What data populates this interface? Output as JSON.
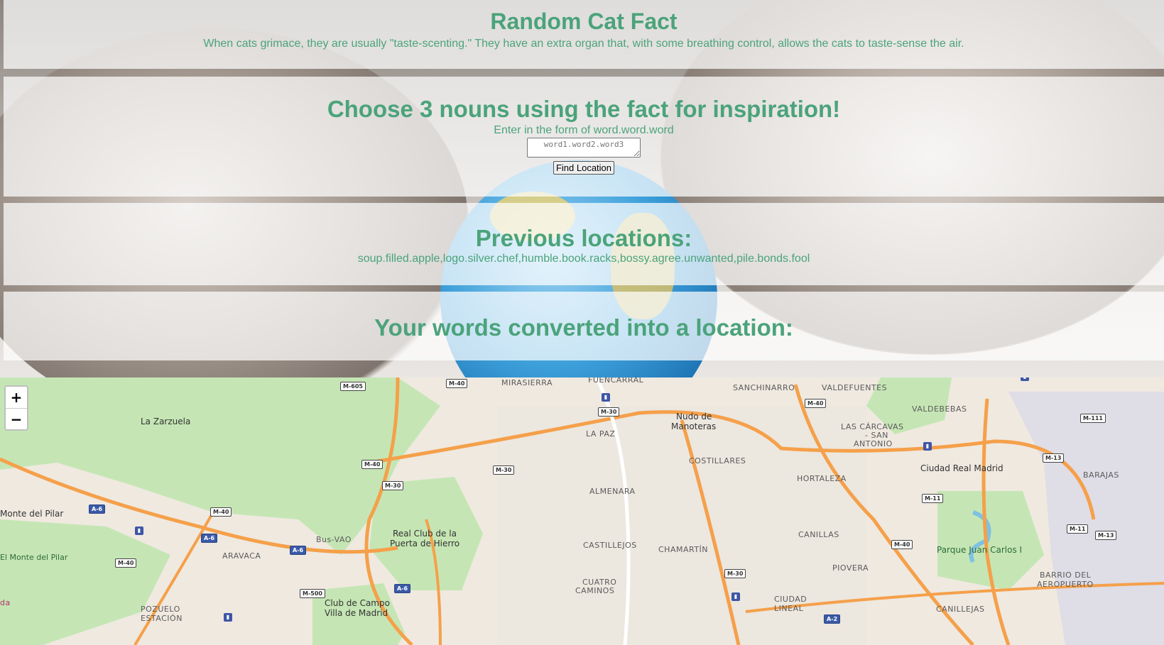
{
  "fact": {
    "title": "Random Cat Fact",
    "text": "When cats grimace, they are usually \"taste-scenting.\" They have an extra organ that, with some breathing control, allows the cats to taste-sense the air."
  },
  "choose": {
    "title": "Choose 3 nouns using the fact for inspiration!",
    "hint": "Enter in the form of word.word.word",
    "input_placeholder": "word1.word2.word3",
    "input_value": "",
    "button_label": "Find Location"
  },
  "previous": {
    "title": "Previous locations:",
    "list": "soup.filled.apple,logo.silver.chef,humble.book.racks,bossy.agree.unwanted,pile.bonds.fool"
  },
  "result": {
    "title": "Your words converted into a location:"
  },
  "map": {
    "zoom_in": "+",
    "zoom_out": "−",
    "labels": {
      "mirasierra": "MIRASIERRA",
      "fuencarral": "FUENCARRAL",
      "sanchinarro": "SANCHINARRO",
      "valdefuentes": "VALDEFUENTES",
      "la_zarzuela": "La Zarzuela",
      "nudo_1": "Nudo de",
      "nudo_2": "Manoteras",
      "valdebebas": "VALDEBEBAS",
      "la_paz": "LA PAZ",
      "carcavas_1": "LAS CÁRCAVAS",
      "carcavas_2": "- SAN",
      "carcavas_3": "ANTONIO",
      "costillares": "COSTILLARES",
      "ciudad_real_madrid": "Ciudad Real Madrid",
      "barajas": "BARAJAS",
      "hortaleza": "HORTALEZA",
      "almenara": "ALMENARA",
      "monte_pilar": "Monte del Pilar",
      "canillas": "CANILLAS",
      "real_club_1": "Real Club de la",
      "real_club_2": "Puerta de Hierro",
      "castillejos": "CASTILLEJOS",
      "chamartin": "CHAMARTÍN",
      "parque_juan_carlos": "Parque Juan Carlos I",
      "el_monte_pilar": "El Monte del Pilar",
      "aravaca": "ARAVACA",
      "bus_vao": "Bus-VAO",
      "piovera": "PIOVERA",
      "barrio_aeropuerto_1": "BARRIO DEL",
      "barrio_aeropuerto_2": "AEROPUERTO",
      "cuatro_caminos_1": "CUATRO",
      "cuatro_caminos_2": "CAMINOS",
      "club_campo_1": "Club de Campo",
      "club_campo_2": "Villa de Madrid",
      "ciudad_lineal_1": "CIUDAD",
      "ciudad_lineal_2": "LINEAL",
      "pozuelo_1": "POZUELO",
      "pozuelo_2": "ESTACIÓN",
      "canillejas": "CANILLEJAS",
      "da": "da"
    },
    "roads": {
      "m605": "M-605",
      "m40_a": "M-40",
      "m40_b": "M-40",
      "m40_c": "M-40",
      "m40_d": "M-40",
      "m40_e": "M-40",
      "m40_f": "M-40",
      "m30_a": "M-30",
      "m30_b": "M-30",
      "m30_c": "M-30",
      "m30_d": "M-30",
      "m111": "M-111",
      "m13_a": "M-13",
      "m13_b": "M-13",
      "m11_a": "M-11",
      "m11_b": "M-11",
      "a6_a": "A-6",
      "a6_b": "A-6",
      "a6_c": "A-6",
      "a6_d": "A-6",
      "m500": "M-500",
      "a2": "A-2"
    },
    "colors": {
      "land": "#efe9e0",
      "park": "#c5e6b4",
      "motorway": "#f5a04a",
      "water": "#9ccfe8"
    }
  }
}
